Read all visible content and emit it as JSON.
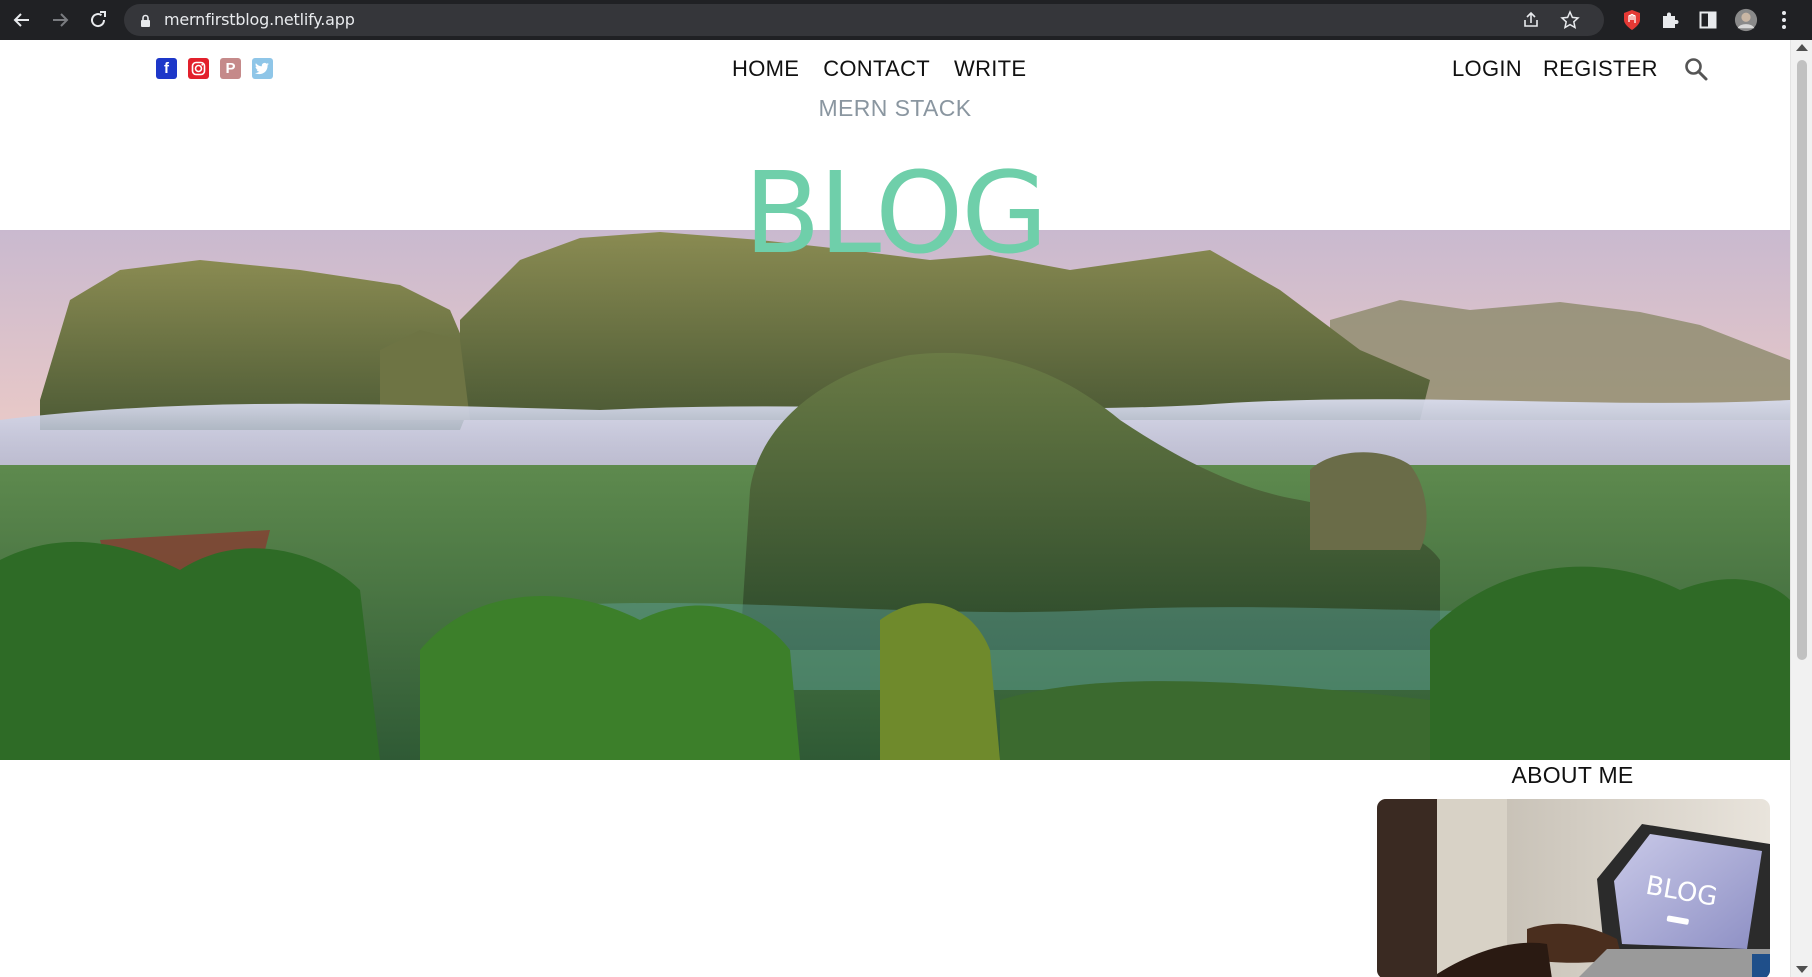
{
  "browser": {
    "url": "mernfirstblog.netlify.app",
    "back_icon": "arrow-left-icon",
    "forward_icon": "arrow-right-icon",
    "reload_icon": "reload-icon",
    "lock_icon": "lock-icon",
    "share_icon": "share-icon",
    "bookmark_icon": "star-icon",
    "extensions": [
      "red-extension-icon",
      "puzzle-icon",
      "sidepanel-icon",
      "avatar",
      "kebab-menu-icon"
    ]
  },
  "topbar": {
    "social": [
      {
        "name": "facebook",
        "glyph": "f",
        "color": "#1d37c9"
      },
      {
        "name": "instagram",
        "glyph": "◎",
        "color": "#e2202c"
      },
      {
        "name": "pinterest",
        "glyph": "P",
        "color": "#c58a8a"
      },
      {
        "name": "twitter",
        "glyph": "t",
        "color": "#8fc6e8"
      }
    ],
    "menu": [
      "HOME",
      "CONTACT",
      "WRITE"
    ],
    "login": "LOGIN",
    "register": "REGISTER",
    "search_icon": "search-icon"
  },
  "header": {
    "subtitle": "MERN STACK",
    "title": "BLOG",
    "title_color": "#6fcfaa"
  },
  "sidebar": {
    "about_title": "ABOUT ME",
    "about_image_text": "BLOG"
  }
}
